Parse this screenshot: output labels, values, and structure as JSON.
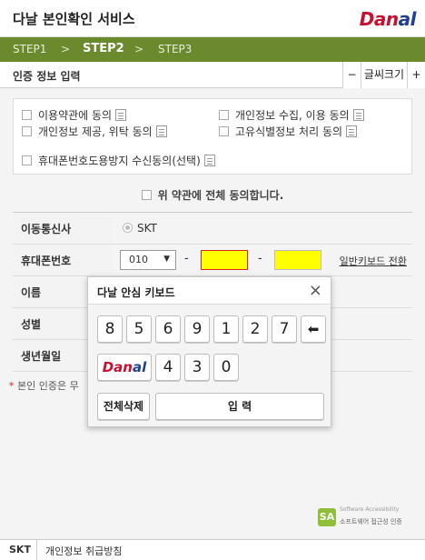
{
  "header": {
    "title": "다날 본인확인 서비스",
    "logo_main": "Dan",
    "logo_accent": "al"
  },
  "steps": {
    "step1": "STEP1",
    "step2": "STEP2",
    "step3": "STEP3",
    "separator": ">",
    "active": "STEP2"
  },
  "infobar": {
    "label": "인증 정보 입력",
    "minus": "−",
    "font_size": "글씨크기",
    "plus": "+"
  },
  "terms": [
    {
      "label": "이용약관에 동의",
      "checked": false
    },
    {
      "label": "개인정보 수집, 이용 동의",
      "checked": false
    },
    {
      "label": "개인정보 제공, 위탁 동의",
      "checked": false
    },
    {
      "label": "고유식별정보 처리 동의",
      "checked": false
    },
    {
      "label": "휴대폰번호도용방지 수신동의(선택)",
      "checked": false
    }
  ],
  "agree_all": "위 약관에 전체 동의합니다.",
  "form": {
    "carrier_label": "이동통신사",
    "carrier_value": "SKT",
    "phone_label": "휴대폰번호",
    "phone_prefix": "010",
    "phone_dash": "-",
    "keyboard_switch": "일반키보드 전환",
    "name_label": "이름",
    "gender_label": "성별",
    "birth_label": "생년월일"
  },
  "note": {
    "star": "*",
    "text": "본인 인증은 무"
  },
  "keyboard": {
    "title": "다날 안심 키보드",
    "close": "×",
    "row1": [
      "8",
      "5",
      "6",
      "9",
      "1",
      "2",
      "7"
    ],
    "backspace": "⬅",
    "row2": [
      "4",
      "3",
      "0"
    ],
    "clear_all": "전체삭제",
    "enter": "입 력",
    "logo_main": "Dan",
    "logo_accent": "al"
  },
  "footer_badge": {
    "abbr": "SA",
    "en": "Software Accessibility",
    "ko": "소프트웨어 접근성 인증"
  },
  "bottom": {
    "carrier": "SKT",
    "privacy": "개인정보 취급방침"
  },
  "colors": {
    "step_bar": "#6b8a2e",
    "highlight_input": "#ffff00",
    "error_border": "#e02020",
    "brand_red": "#c8102e",
    "brand_blue": "#1f3f8f"
  }
}
